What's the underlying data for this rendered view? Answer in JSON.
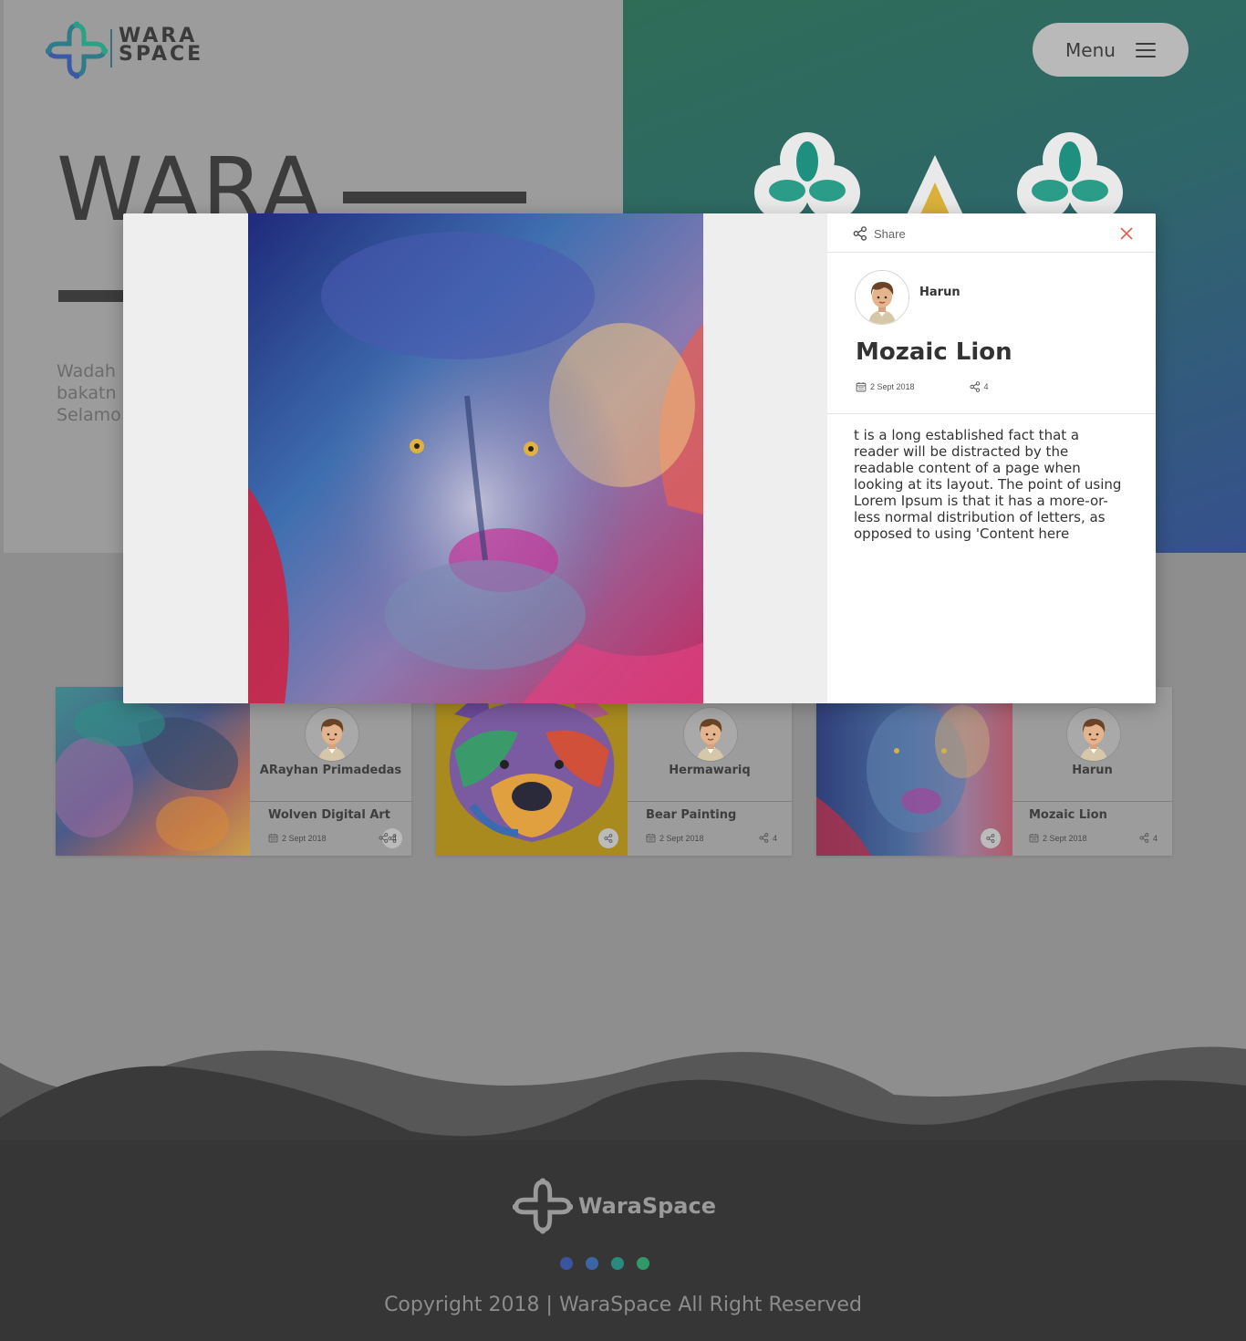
{
  "brand": {
    "logo_line1": "WARA",
    "logo_line2": "SPACE",
    "footer_name": "WaraSpace",
    "colors": {
      "dark": "#3c3c3c",
      "teal": "#1f8f7f",
      "blue": "#3a5aa8",
      "green": "#2f9e6e",
      "accent_red": "#e05a4b"
    }
  },
  "header": {
    "menu_label": "Menu",
    "menu_icon": "hamburger-icon"
  },
  "hero": {
    "title": "WARA",
    "description_line1": "Wadah",
    "description_line2": "bakatn",
    "description_line3": "Selamo"
  },
  "cards": [
    {
      "author": "ARayhan Primadedas",
      "title": "Wolven Digital Art",
      "date": "2 Sept 2018",
      "shares": "4",
      "art": "wolf-art"
    },
    {
      "author": "Hermawariq",
      "title": "Bear Painting",
      "date": "2 Sept 2018",
      "shares": "4",
      "art": "bear-art"
    },
    {
      "author": "Harun",
      "title": "Mozaic Lion",
      "date": "2 Sept 2018",
      "shares": "4",
      "art": "lion-art"
    }
  ],
  "modal": {
    "share_label": "Share",
    "author": "Harun",
    "title": "Mozaic Lion",
    "date": "2 Sept 2018",
    "shares": "4",
    "description": "t is a long established fact that a reader will be distracted by the readable content of a page when looking at its layout. The point of using Lorem Ipsum is that it has a more-or-less normal distribution of letters, as opposed to using 'Content here"
  },
  "footer": {
    "dots": [
      "#3a55a0",
      "#3b66a3",
      "#2b8a80",
      "#2f9a68"
    ],
    "copyright": "Copyright 2018 | WaraSpace All Right Reserved"
  }
}
